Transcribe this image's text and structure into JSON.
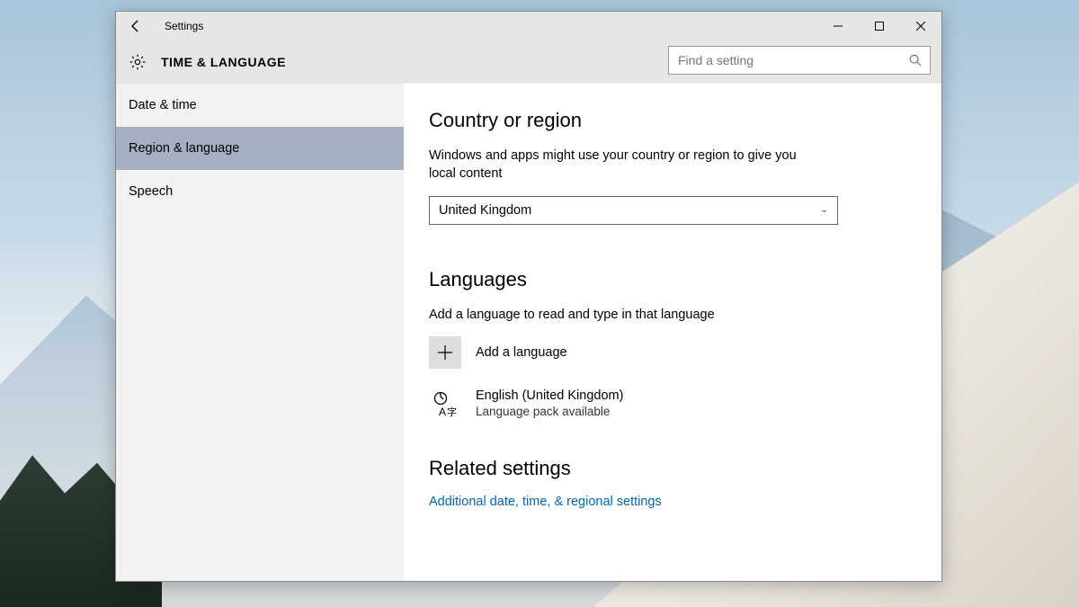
{
  "titlebar": {
    "title": "Settings"
  },
  "header": {
    "title": "TIME & LANGUAGE"
  },
  "search": {
    "placeholder": "Find a setting"
  },
  "sidebar": {
    "items": [
      {
        "label": "Date & time"
      },
      {
        "label": "Region & language"
      },
      {
        "label": "Speech"
      }
    ],
    "selected": 1
  },
  "main": {
    "region": {
      "heading": "Country or region",
      "desc": "Windows and apps might use your country or region to give you local content",
      "selected": "United Kingdom"
    },
    "languages": {
      "heading": "Languages",
      "desc": "Add a language to read and type in that language",
      "add_label": "Add a language",
      "items": [
        {
          "name": "English (United Kingdom)",
          "sub": "Language pack available"
        }
      ]
    },
    "related": {
      "heading": "Related settings",
      "link": "Additional date, time, & regional settings"
    }
  }
}
